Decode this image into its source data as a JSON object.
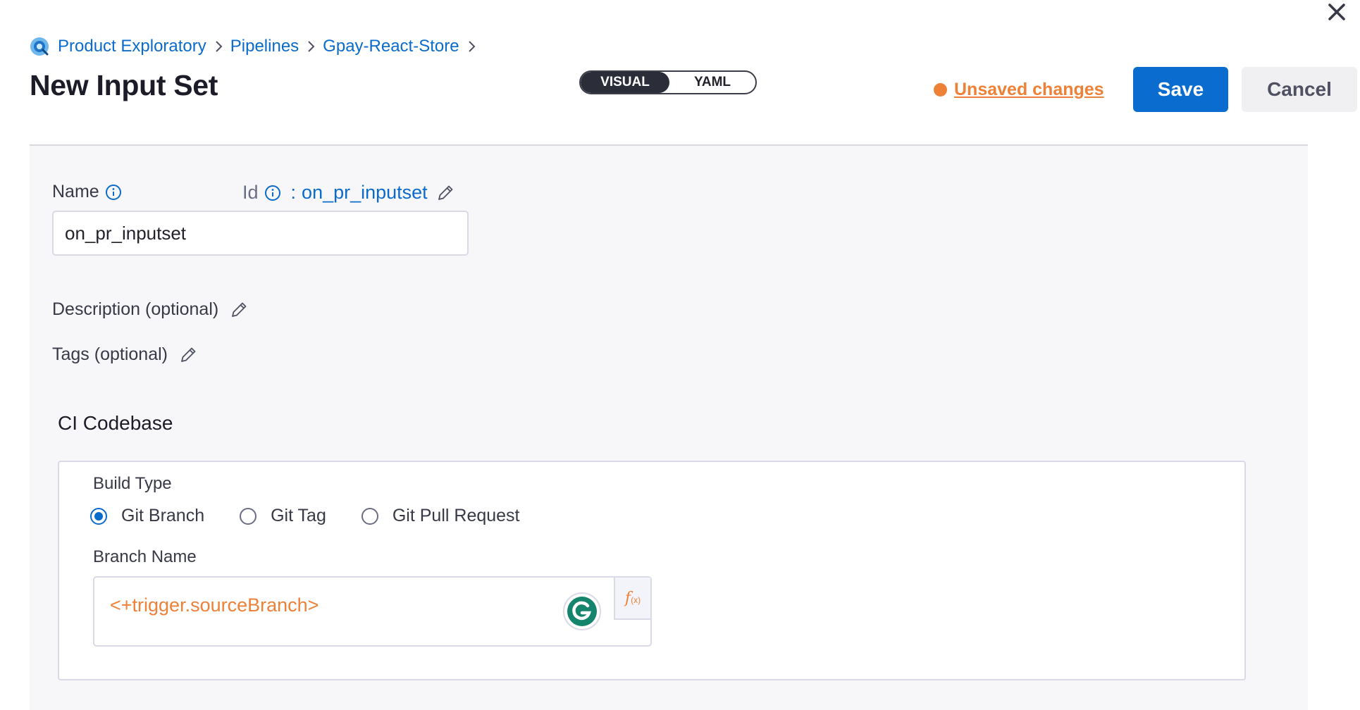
{
  "breadcrumb": {
    "items": [
      "Product Exploratory",
      "Pipelines",
      "Gpay-React-Store"
    ]
  },
  "page": {
    "title": "New Input Set"
  },
  "view_toggle": {
    "visual": "VISUAL",
    "yaml": "YAML",
    "active": "VISUAL"
  },
  "status": {
    "unsaved": "Unsaved changes",
    "color": "#ee8138"
  },
  "actions": {
    "save": "Save",
    "cancel": "Cancel"
  },
  "form": {
    "name_label": "Name",
    "id_label": "Id",
    "id_colon": ":",
    "id_value": "on_pr_inputset",
    "name_value": "on_pr_inputset",
    "description_label": "Description (optional)",
    "tags_label": "Tags (optional)"
  },
  "codebase": {
    "title": "CI Codebase",
    "build_type_label": "Build Type",
    "build_types": [
      {
        "label": "Git Branch",
        "checked": true
      },
      {
        "label": "Git Tag",
        "checked": false
      },
      {
        "label": "Git Pull Request",
        "checked": false
      }
    ],
    "branch_label": "Branch Name",
    "branch_value": "<+trigger.sourceBranch>",
    "expression_icon": "fx-icon"
  },
  "colors": {
    "brand_blue": "#0b6ccf",
    "warning_orange": "#ee8138"
  }
}
